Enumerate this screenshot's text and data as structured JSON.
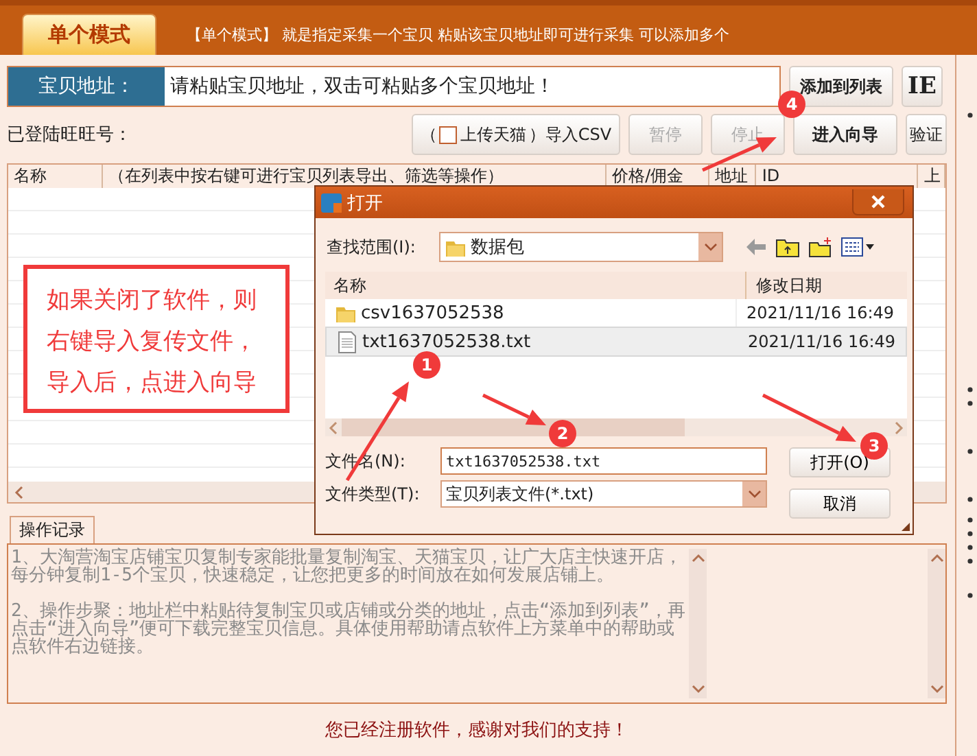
{
  "mode_tab": {
    "label": "单个模式",
    "selected": true
  },
  "mode_description": "【单个模式】 就是指定采集一个宝贝 粘贴该宝贝地址即可进行采集 可以添加多个",
  "url_field": {
    "label": "宝贝地址：",
    "value": "请粘贴宝贝地址，双击可粘贴多个宝贝地址！"
  },
  "url_buttons": [
    "添加到列表",
    "IE"
  ],
  "account_label": "已登陆旺旺号：",
  "import_button": {
    "prefix": "（",
    "checkbox_label": "上传天猫",
    "checked": false,
    "suffix": "）导入CSV"
  },
  "toolbar_buttons": [
    {
      "label": "暂停",
      "disabled": true
    },
    {
      "label": "停止",
      "disabled": true
    },
    {
      "label": "进入向导",
      "disabled": false
    },
    {
      "label": "验证",
      "disabled": false
    }
  ],
  "table": {
    "columns": [
      "名称",
      "（在列表中按右键可进行宝贝列表导出、筛选等操作）",
      "价格/佣金",
      "地址",
      "ID",
      "上"
    ]
  },
  "log": {
    "tab": "操作记录",
    "paragraphs": [
      "1、大淘营淘宝店铺宝贝复制专家能批量复制淘宝、天猫宝贝，让广大店主快速开店，每分钟复制1-5个宝贝，快速稳定，让您把更多的时间放在如何发展店铺上。",
      "2、操作步聚：地址栏中粘贴待复制宝贝或店铺或分类的地址，点击“添加到列表”，再点击“进入向导”便可下载完整宝贝信息。具体使用帮助请点软件上方菜单中的帮助或点软件右边链接。"
    ]
  },
  "footer": "您已经注册软件，感谢对我们的支持！",
  "dialog": {
    "title": "打开",
    "look_in_label": "查找范围(I):",
    "look_in_value": "数据包",
    "columns": [
      "名称",
      "修改日期"
    ],
    "files": [
      {
        "name": "csv1637052538",
        "date": "2021/11/16 16:49",
        "kind": "folder",
        "selected": false
      },
      {
        "name": "txt1637052538.txt",
        "date": "2021/11/16 16:49",
        "kind": "file",
        "selected": true
      }
    ],
    "filename_label": "文件名(N):",
    "filename_value": "txt1637052538.txt",
    "filetype_label": "文件类型(T):",
    "filetype_value": "宝贝列表文件(*.txt)",
    "buttons": [
      "打开(O)",
      "取消"
    ]
  },
  "annotation": {
    "note": "如果关闭了软件，则右键导入复传文件，导入后，点进入向导",
    "markers": [
      "1",
      "2",
      "3",
      "4"
    ]
  }
}
